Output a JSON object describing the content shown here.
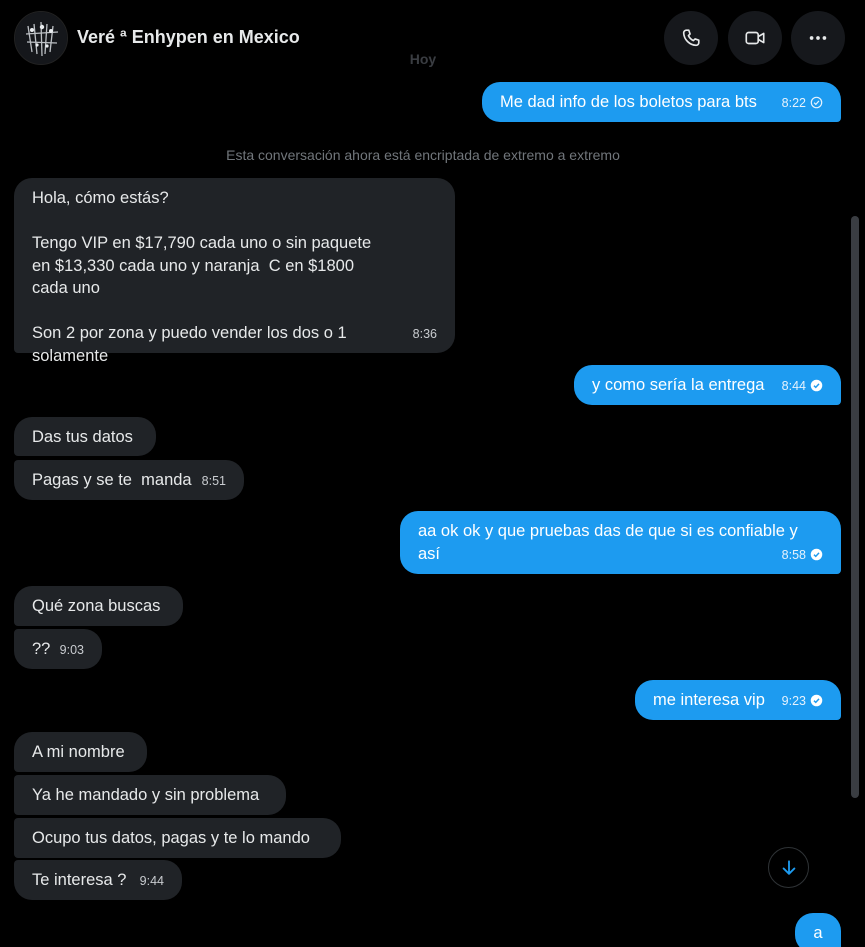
{
  "header": {
    "title": "Veré ª Enhypen en Mexico",
    "date_separator": "Hoy",
    "icons": {
      "phone": "phone-icon",
      "video": "video-icon",
      "more": "more-icon"
    }
  },
  "notice": "Esta conversación ahora está encriptada de extremo a extremo",
  "messages": [
    {
      "dir": "sent",
      "text": "Me dad info de los boletos para bts",
      "time": "8:22",
      "status": "sent"
    },
    {
      "dir": "recv",
      "text": "Hola, cómo estás?\n\nTengo VIP en $17,790 cada uno o sin paquete en $13,330 cada uno y naranja  C en $1800 cada uno\n\nSon 2 por zona y puedo vender los dos o 1 solamente",
      "time": "8:36"
    },
    {
      "dir": "sent",
      "text": "y como sería la entrega",
      "time": "8:44",
      "status": "read"
    },
    {
      "dir": "recv",
      "text": "Das tus datos",
      "time": ""
    },
    {
      "dir": "recv",
      "text": "Pagas y se te  manda",
      "time": "8:51"
    },
    {
      "dir": "sent",
      "text": "aa ok ok y que pruebas das de que si es confiable y así",
      "time": "8:58",
      "status": "read"
    },
    {
      "dir": "recv",
      "text": "Qué zona buscas",
      "time": ""
    },
    {
      "dir": "recv",
      "text": "??",
      "time": "9:03"
    },
    {
      "dir": "sent",
      "text": "me interesa vip",
      "time": "9:23",
      "status": "read"
    },
    {
      "dir": "recv",
      "text": "A mi nombre",
      "time": ""
    },
    {
      "dir": "recv",
      "text": "Ya he mandado y sin problema",
      "time": ""
    },
    {
      "dir": "recv",
      "text": "Ocupo tus datos, pagas y te lo mando",
      "time": ""
    },
    {
      "dir": "recv",
      "text": "Te interesa ?",
      "time": "9:44"
    },
    {
      "dir": "sent",
      "text": "a",
      "time": ""
    }
  ],
  "colors": {
    "accent": "#1d9bf0",
    "received_bubble": "#202327",
    "background": "#000000"
  }
}
